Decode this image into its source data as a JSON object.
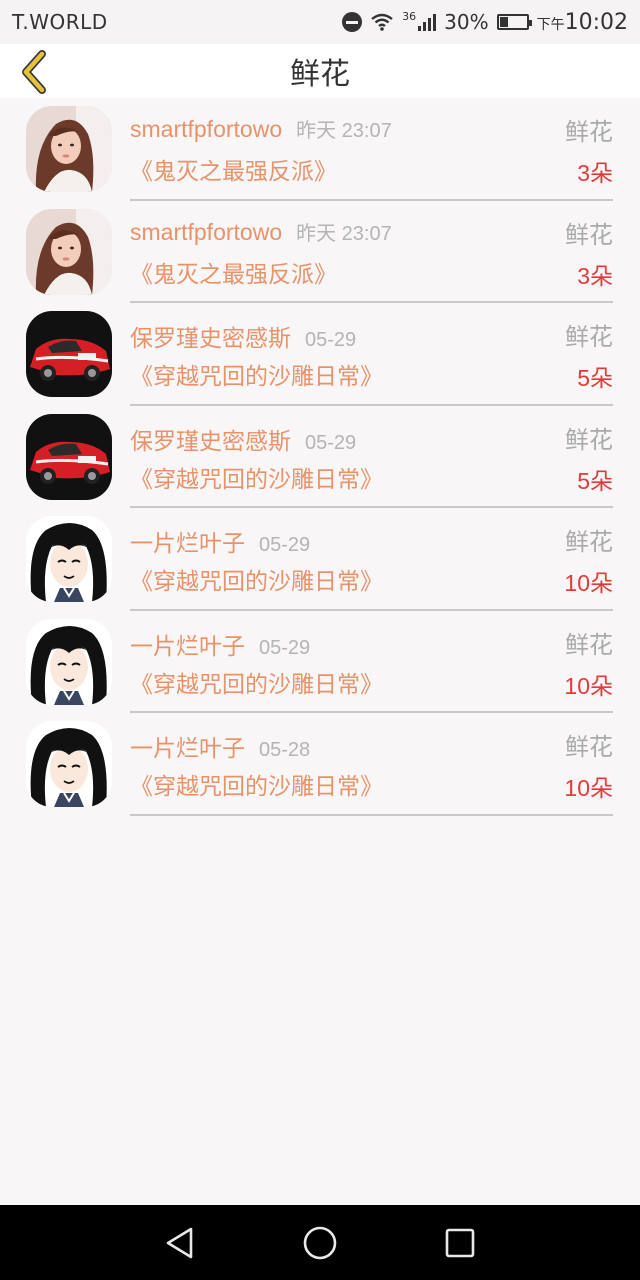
{
  "status_bar": {
    "carrier": "T.WORLD",
    "network": "36",
    "battery": "30%",
    "time_prefix": "下午",
    "time": "10:02"
  },
  "header": {
    "title": "鲜花"
  },
  "list": [
    {
      "username": "smartfpfortowo",
      "time": "昨天 23:07",
      "gift_type": "鲜花",
      "book": "《鬼灭之最强反派》",
      "count": "3朵",
      "avatar": "girl-photo"
    },
    {
      "username": "smartfpfortowo",
      "time": "昨天 23:07",
      "gift_type": "鲜花",
      "book": "《鬼灭之最强反派》",
      "count": "3朵",
      "avatar": "girl-photo"
    },
    {
      "username": "保罗瑾史密感斯",
      "time": "05-29",
      "gift_type": "鲜花",
      "book": "《穿越咒回的沙雕日常》",
      "count": "5朵",
      "avatar": "rally-car"
    },
    {
      "username": "保罗瑾史密感斯",
      "time": "05-29",
      "gift_type": "鲜花",
      "book": "《穿越咒回的沙雕日常》",
      "count": "5朵",
      "avatar": "rally-car"
    },
    {
      "username": "一片烂叶子",
      "time": "05-29",
      "gift_type": "鲜花",
      "book": "《穿越咒回的沙雕日常》",
      "count": "10朵",
      "avatar": "anime-character"
    },
    {
      "username": "一片烂叶子",
      "time": "05-29",
      "gift_type": "鲜花",
      "book": "《穿越咒回的沙雕日常》",
      "count": "10朵",
      "avatar": "anime-character"
    },
    {
      "username": "一片烂叶子",
      "time": "05-28",
      "gift_type": "鲜花",
      "book": "《穿越咒回的沙雕日常》",
      "count": "10朵",
      "avatar": "anime-character"
    }
  ],
  "colors": {
    "accent": "#e8926a",
    "count": "#e23a3a",
    "back_arrow": "#e6c23a"
  },
  "nav": {
    "icons": [
      "back-triangle-icon",
      "home-circle-icon",
      "recents-square-icon"
    ]
  }
}
